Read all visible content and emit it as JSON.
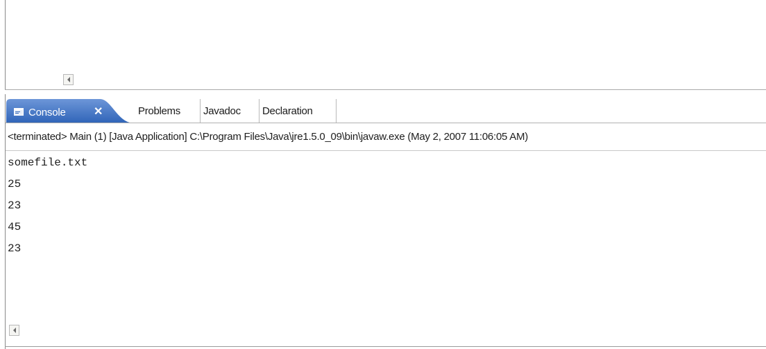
{
  "tabs": {
    "active": {
      "label": "Console",
      "close_glyph": "✕",
      "icon": "console-icon"
    },
    "items": [
      {
        "label": "Problems"
      },
      {
        "label": "Javadoc"
      },
      {
        "label": "Declaration"
      }
    ]
  },
  "console": {
    "status": "<terminated> Main (1) [Java Application] C:\\Program Files\\Java\\jre1.5.0_09\\bin\\javaw.exe (May 2, 2007 11:06:05 AM)",
    "output": [
      "somefile.txt",
      "25",
      "23",
      "45",
      "23"
    ]
  },
  "colors": {
    "active_tab": "#2f64b8",
    "active_tab_light": "#6d96d8"
  }
}
